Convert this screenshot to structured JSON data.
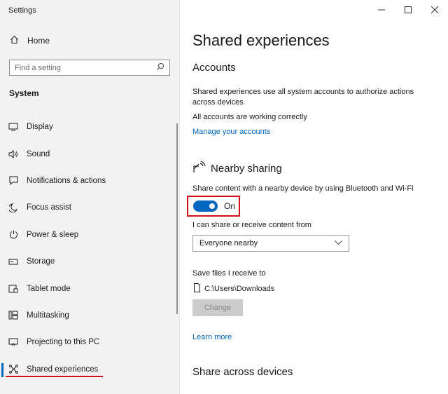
{
  "window": {
    "title": "Settings"
  },
  "sidebar": {
    "home_label": "Home",
    "search_placeholder": "Find a setting",
    "section_title": "System",
    "items": [
      {
        "label": "Display",
        "icon": "monitor-icon"
      },
      {
        "label": "Sound",
        "icon": "speaker-icon"
      },
      {
        "label": "Notifications & actions",
        "icon": "notification-icon"
      },
      {
        "label": "Focus assist",
        "icon": "moon-icon"
      },
      {
        "label": "Power & sleep",
        "icon": "power-icon"
      },
      {
        "label": "Storage",
        "icon": "storage-icon"
      },
      {
        "label": "Tablet mode",
        "icon": "tablet-icon"
      },
      {
        "label": "Multitasking",
        "icon": "multitasking-icon"
      },
      {
        "label": "Projecting to this PC",
        "icon": "projector-icon"
      },
      {
        "label": "Shared experiences",
        "icon": "shared-icon",
        "active": true
      }
    ]
  },
  "main": {
    "page_title": "Shared experiences",
    "accounts": {
      "heading": "Accounts",
      "description": "Shared experiences use all system accounts to authorize actions across devices",
      "status": "All accounts are working correctly",
      "manage_link": "Manage your accounts"
    },
    "nearby": {
      "heading": "Nearby sharing",
      "description": "Share content with a nearby device by using Bluetooth and Wi-Fi",
      "toggle_state": "On",
      "share_from_label": "I can share or receive content from",
      "share_from_value": "Everyone nearby",
      "save_label": "Save files I receive to",
      "save_path": "C:\\Users\\Downloads",
      "change_button": "Change",
      "learn_more": "Learn more"
    },
    "share_across_heading": "Share across devices"
  },
  "colors": {
    "accent": "#0067c0",
    "highlight_red": "#d20f1a"
  }
}
